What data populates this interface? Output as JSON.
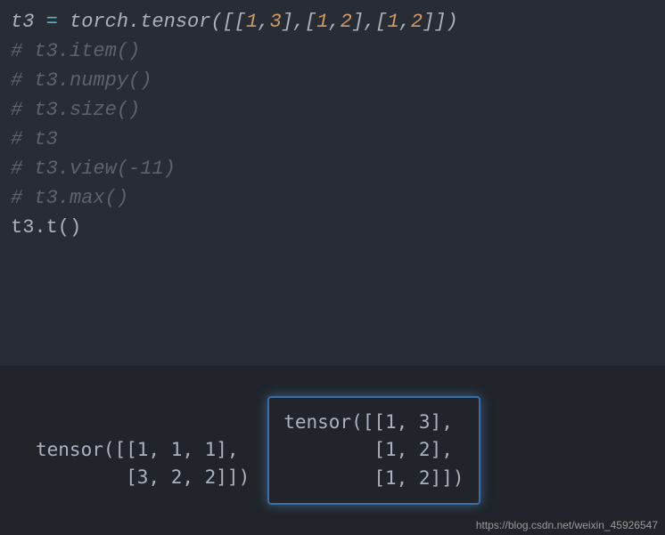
{
  "code": {
    "line1": {
      "var": "t3 ",
      "op": "=",
      "text1": " torch.tensor([[",
      "n1": "1",
      "c1": ",",
      "n2": "3",
      "c2": "],[",
      "n3": "1",
      "c3": ",",
      "n4": "2",
      "c4": "],[",
      "n5": "1",
      "c5": ",",
      "n6": "2",
      "c6": "]])"
    },
    "line2": "# t3.item()",
    "line3": "# t3.numpy()",
    "line4": "# t3.size()",
    "line5": "# t3",
    "line6": "# t3.view(-11)",
    "line7": "# t3.max()",
    "line8": "t3.t()"
  },
  "output": {
    "left": "tensor([[1, 1, 1],\n        [3, 2, 2]])",
    "right": "tensor([[1, 3],\n        [1, 2],\n        [1, 2]])"
  },
  "watermark": "https://blog.csdn.net/weixin_45926547"
}
